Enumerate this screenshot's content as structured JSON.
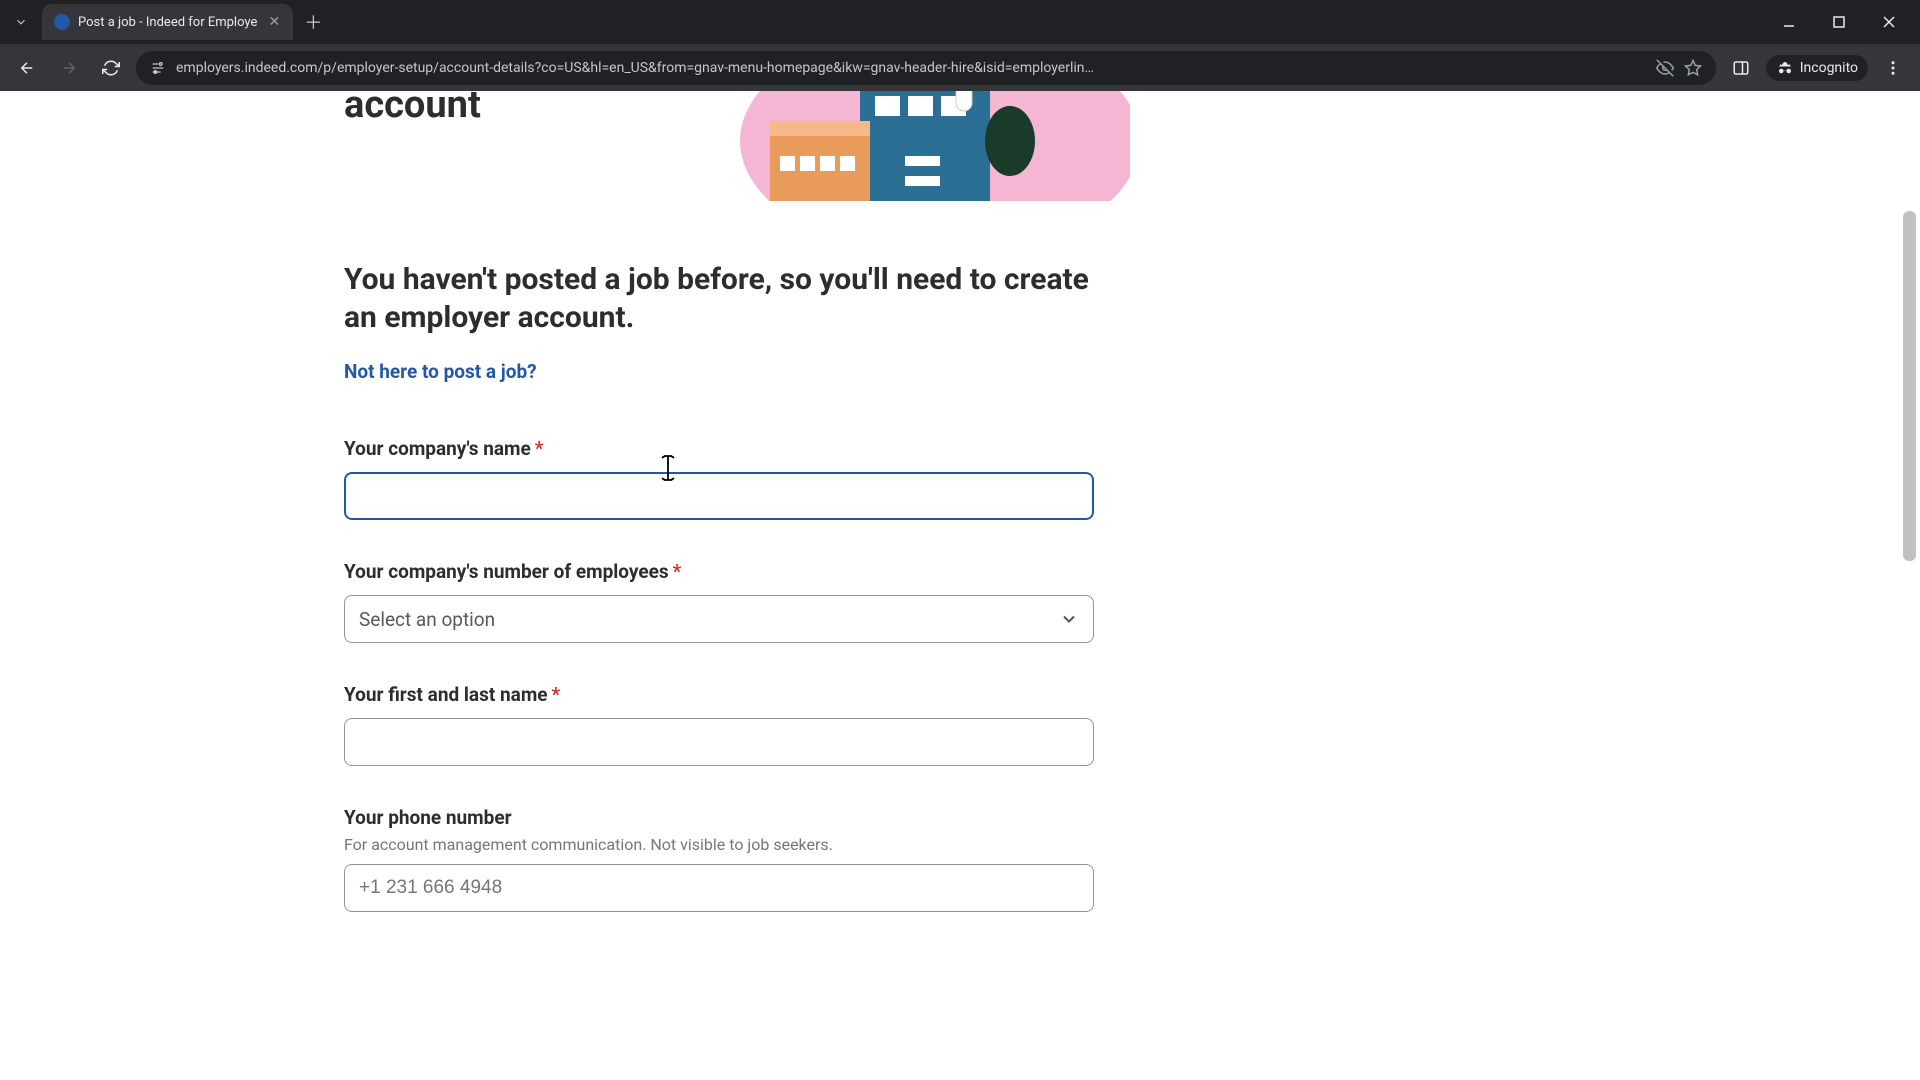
{
  "browser": {
    "tab_title": "Post a job - Indeed for Employe",
    "url": "employers.indeed.com/p/employer-setup/account-details?co=US&hl=en_US&from=gnav-menu-homepage&ikw=gnav-header-hire&isid=employerlin…",
    "incognito_label": "Incognito"
  },
  "hero": {
    "title_tail": "account"
  },
  "prompt": "You haven't posted a job before, so you'll need to create an employer account.",
  "link_text": "Not here to post a job?",
  "fields": {
    "company_name": {
      "label": "Your company's name",
      "value": ""
    },
    "employees": {
      "label": "Your company's number of employees",
      "placeholder": "Select an option"
    },
    "full_name": {
      "label": "Your first and last name",
      "value": ""
    },
    "phone": {
      "label": "Your phone number",
      "helper": "For account management communication. Not visible to job seekers.",
      "value": "+1 231 666 4948"
    }
  }
}
